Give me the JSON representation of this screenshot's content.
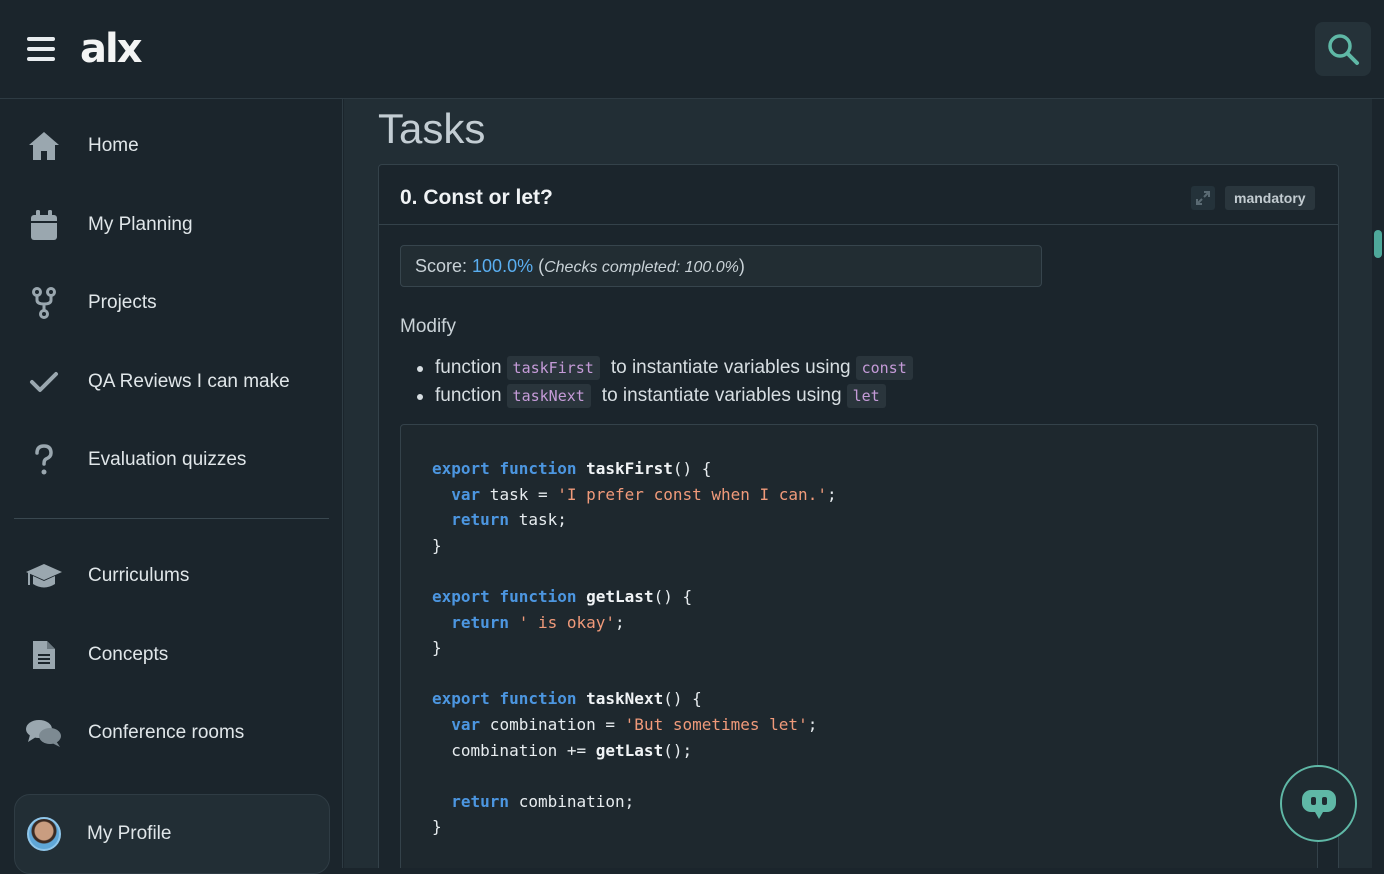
{
  "header": {
    "logo_text": "alx",
    "menu_icon": "hamburger-icon",
    "search_icon": "search-icon"
  },
  "sidebar": {
    "items": [
      {
        "label": "Home",
        "icon": "home-icon"
      },
      {
        "label": "My Planning",
        "icon": "calendar-icon"
      },
      {
        "label": "Projects",
        "icon": "fork-icon"
      },
      {
        "label": "QA Reviews I can make",
        "icon": "checkmark-icon"
      },
      {
        "label": "Evaluation quizzes",
        "icon": "question-icon"
      },
      {
        "label": "Curriculums",
        "icon": "graduation-cap-icon"
      },
      {
        "label": "Concepts",
        "icon": "document-icon"
      },
      {
        "label": "Conference rooms",
        "icon": "chat-bubbles-icon"
      }
    ],
    "profile": {
      "label": "My Profile",
      "icon": "avatar"
    }
  },
  "main": {
    "page_title": "Tasks",
    "task": {
      "title": "0. Const or let?",
      "badge": "mandatory",
      "score_label": "Score: ",
      "score_value": "100.0%",
      "score_open": " (",
      "score_checks": "Checks completed: 100.0%",
      "score_close": ")",
      "modify": "Modify",
      "bullets": [
        {
          "pre": "function",
          "code1": "taskFirst",
          "mid": "to instantiate variables using",
          "code2": "const"
        },
        {
          "pre": "function",
          "code1": "taskNext",
          "mid": "to instantiate variables using",
          "code2": "let"
        }
      ]
    }
  },
  "colors": {
    "accent": "#5fb8a6",
    "score": "#5aaef0",
    "keyword": "#4c96e0",
    "string": "#f09a7a",
    "inline_code": "#c59bd8"
  }
}
